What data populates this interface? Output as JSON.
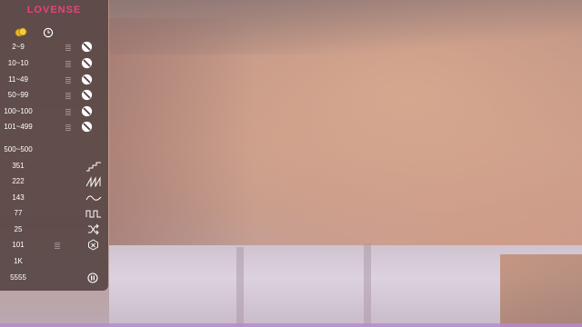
{
  "app": {
    "logo": "LOVENSE"
  },
  "header": {
    "icons": [
      "coins-icon",
      "clock-icon"
    ]
  },
  "tips": [
    {
      "level": "2~9",
      "duration": "",
      "action": "no-icon"
    },
    {
      "level": "10~10",
      "duration": "",
      "action": "no-icon"
    },
    {
      "level": "11~49",
      "duration": "",
      "action": "no-icon"
    },
    {
      "level": "50~99",
      "duration": "",
      "action": "no-icon"
    },
    {
      "level": "100~100",
      "duration": "",
      "action": "no-icon"
    },
    {
      "level": "101~499",
      "duration": "",
      "action": "no-icon"
    }
  ],
  "specials": [
    {
      "level": "500~500",
      "duration": "",
      "extra": "",
      "icon": ""
    },
    {
      "level": "351",
      "duration": "",
      "icon": "step-wave-icon"
    },
    {
      "level": "222",
      "duration": "",
      "icon": "sawtooth-wave-icon"
    },
    {
      "level": "143",
      "duration": "",
      "icon": "sine-wave-icon"
    },
    {
      "level": "77",
      "duration": "",
      "icon": "square-wave-icon"
    },
    {
      "level": "25",
      "duration": "",
      "icon": "shuffle-icon"
    },
    {
      "level": "101",
      "duration": "",
      "icon": "random-icon"
    },
    {
      "level": "1K",
      "duration": "",
      "icon": ""
    },
    {
      "level": "5555",
      "duration": "",
      "icon": "pause-icon"
    }
  ],
  "colors": {
    "accent": "#e9427b",
    "panel_bg": "#4e3e3e",
    "text": "#ffffff"
  }
}
